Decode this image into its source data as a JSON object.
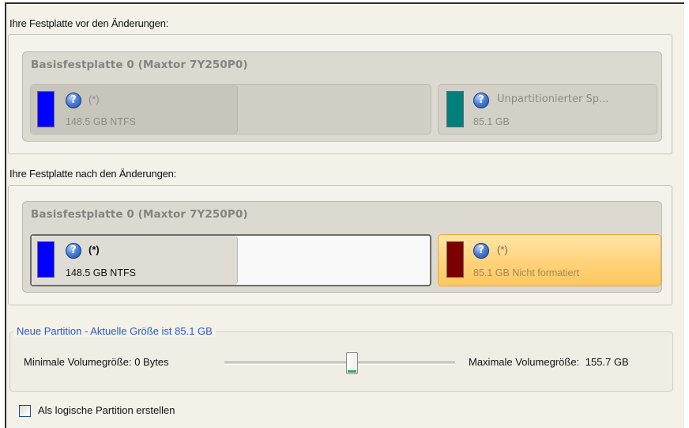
{
  "before": {
    "heading": "Ihre Festplatte vor den Änderungen:",
    "disk_title": "Basisfestplatte 0 (Maxtor 7Y250P0)",
    "partitions": [
      {
        "name": "(*)",
        "size": "148.5 GB NTFS",
        "color": "#0000ff",
        "icon": "help-icon"
      },
      {
        "name": "Unpartitionierter Sp...",
        "size": "85.1 GB",
        "color": "#007f7b",
        "icon": "help-icon"
      }
    ]
  },
  "after": {
    "heading": "Ihre Festplatte nach den Änderungen:",
    "disk_title": "Basisfestplatte 0 (Maxtor 7Y250P0)",
    "partitions": [
      {
        "name": "(*)",
        "size": "148.5 GB NTFS",
        "color": "#0000ff",
        "icon": "help-icon"
      },
      {
        "name": "(*)",
        "size": "85.1 GB Nicht formatiert",
        "color": "#7b0000",
        "icon": "help-icon"
      }
    ]
  },
  "size_group": {
    "legend": "Neue Partition - Aktuelle Größe ist 85.1 GB",
    "min_label": "Minimale Volumegröße:",
    "min_value": "0 Bytes",
    "max_label": "Maximale Volumegröße:",
    "max_value": "155.7 GB",
    "slider_fraction": 0.55
  },
  "logical_checkbox": {
    "label": "Als logische Partition erstellen",
    "checked": false
  },
  "colors": {
    "accent_legend": "#2b5ac7",
    "selected_partition": "#ffd27a"
  }
}
